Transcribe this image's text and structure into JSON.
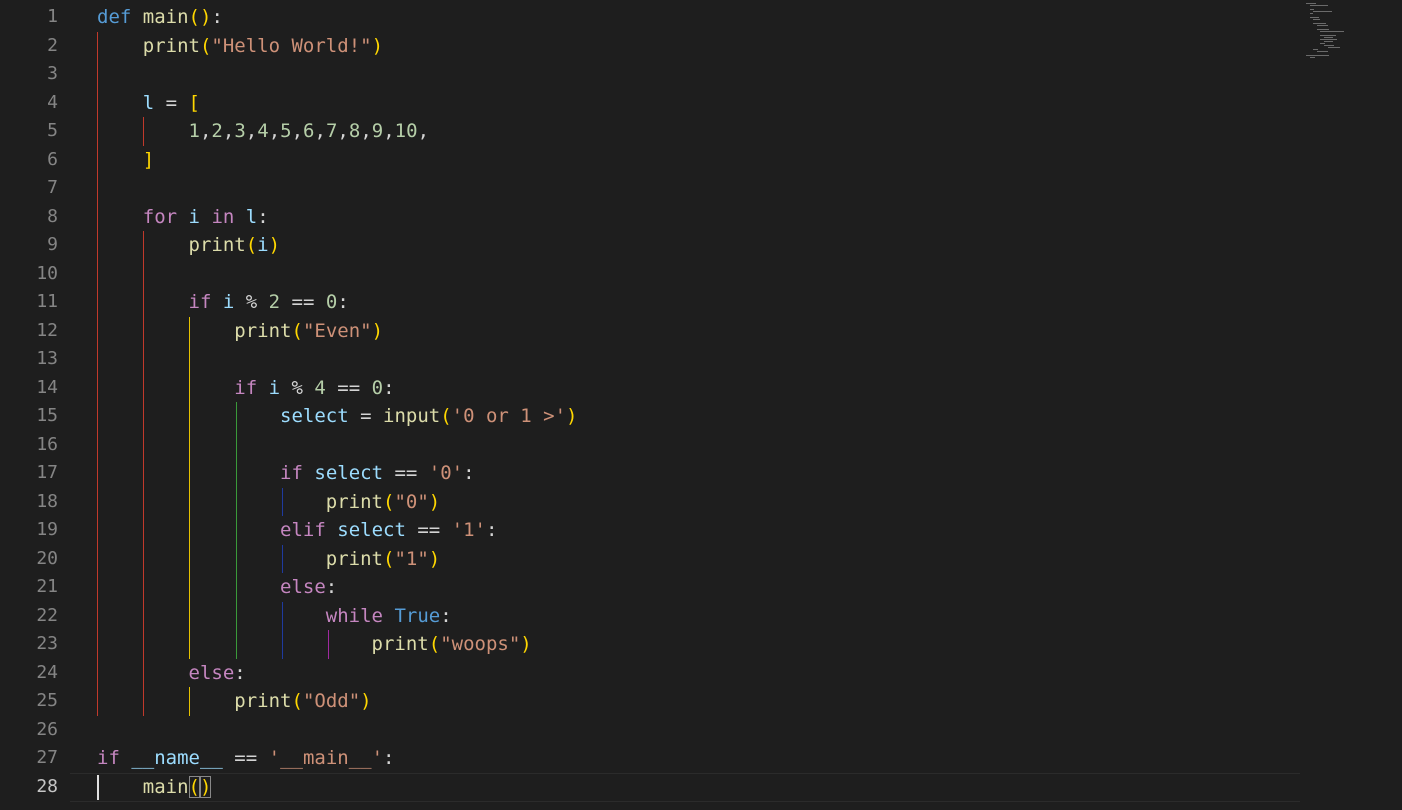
{
  "editor": {
    "language": "python",
    "active_line": 28,
    "colors": {
      "background": "#1e1e1e",
      "keyword": "#569cd6",
      "control": "#c586c0",
      "function": "#dcdcaa",
      "string": "#ce9178",
      "variable": "#9cdcfe",
      "number": "#b5cea8",
      "bracket_level1": "#ffd700",
      "bracket_level2": "#da70d6"
    },
    "line_numbers": [
      "1",
      "2",
      "3",
      "4",
      "5",
      "6",
      "7",
      "8",
      "9",
      "10",
      "11",
      "12",
      "13",
      "14",
      "15",
      "16",
      "17",
      "18",
      "19",
      "20",
      "21",
      "22",
      "23",
      "24",
      "25",
      "26",
      "27",
      "28"
    ],
    "lines": [
      "def main():",
      "    print(\"Hello World!\")",
      "",
      "    l = [",
      "        1,2,3,4,5,6,7,8,9,10,",
      "    ]",
      "",
      "    for i in l:",
      "        print(i)",
      "",
      "        if i % 2 == 0:",
      "            print(\"Even\")",
      "",
      "            if i % 4 == 0:",
      "                select = input('0 or 1 >')",
      "",
      "                if select == '0':",
      "                    print(\"0\")",
      "                elif select == '1':",
      "                    print(\"1\")",
      "                else:",
      "                    while True:",
      "                        print(\"woops\")",
      "        else:",
      "            print(\"Odd\")",
      "",
      "if __name__ == '__main__':",
      "    main()"
    ]
  }
}
